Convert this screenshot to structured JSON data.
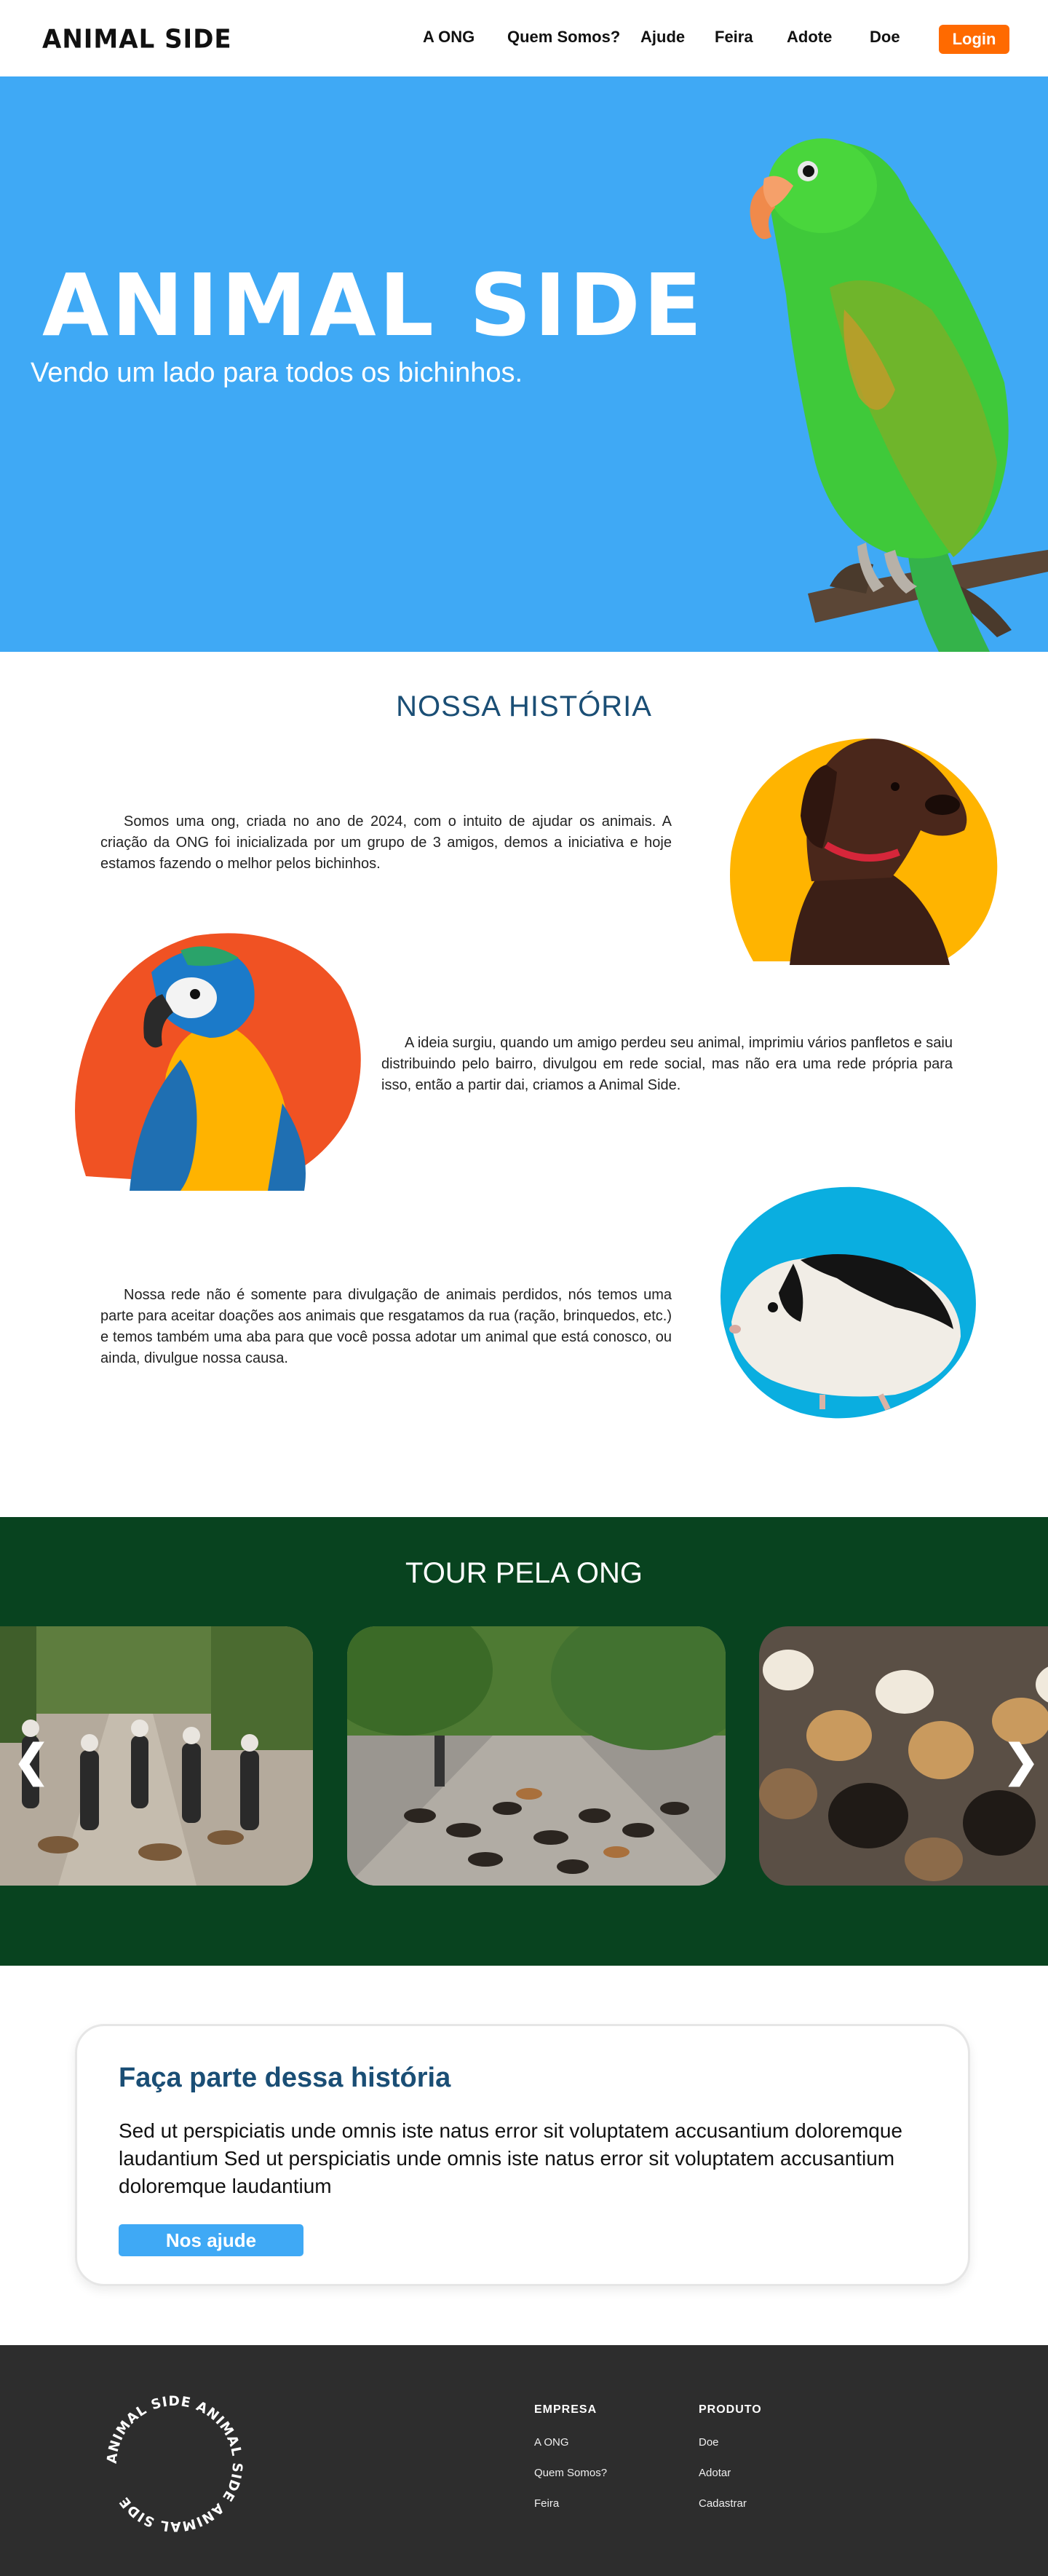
{
  "header": {
    "logo": "ANIMAL SIDE",
    "nav": [
      "A ONG",
      "Quem Somos?",
      "Ajude",
      "Feira",
      "Adote",
      "Doe"
    ],
    "login": "Login"
  },
  "hero": {
    "title": "ANIMAL SIDE",
    "subtitle": "Vendo um lado para todos os bichinhos."
  },
  "history": {
    "title": "NOSSA HISTÓRIA",
    "paragraphs": [
      "Somos uma ong, criada no ano de 2024, com o intuito de ajudar os animais. A criação da ONG foi inicializada por um grupo de 3 amigos, demos a iniciativa e hoje estamos fazendo o melhor pelos bichinhos.",
      "A ideia surgiu, quando um amigo perdeu seu animal, imprimiu vários panfletos e saiu distribuindo pelo bairro, divulgou em rede social, mas não era uma rede própria para isso, então a partir dai, criamos a Animal Side.",
      "Nossa rede não é somente para divulgação de animais perdidos, nós temos uma parte para aceitar doações aos animais que resgatamos da rua (ração, brinquedos, etc.) e temos também uma aba para que você possa adotar um animal que está conosco, ou ainda, divulgue nossa causa."
    ]
  },
  "tour": {
    "title": "TOUR PELA ONG"
  },
  "cta": {
    "title": "Faça parte dessa história",
    "text": "Sed ut perspiciatis unde omnis iste natus error sit voluptatem accusantium doloremque laudantium Sed ut perspiciatis unde omnis iste natus error sit voluptatem accusantium doloremque laudantium",
    "button": "Nos ajude"
  },
  "footer": {
    "circle_text": "ANIMAL SIDE ANIMAL SIDE ANIMAL SIDE ",
    "empresa": {
      "title": "EMPRESA",
      "links": [
        "A ONG",
        "Quem Somos?",
        "Feira"
      ]
    },
    "produto": {
      "title": "PRODUTO",
      "links": [
        "Doe",
        "Adotar",
        "Cadastrar"
      ]
    }
  },
  "colors": {
    "hero_bg": "#3fa9f5",
    "tour_bg": "#08431f",
    "accent_orange": "#ff6a00",
    "title_blue": "#1a4e75",
    "footer_bg": "#2d2d2d"
  },
  "icons": [
    "chevron-left-icon",
    "chevron-right-icon"
  ]
}
